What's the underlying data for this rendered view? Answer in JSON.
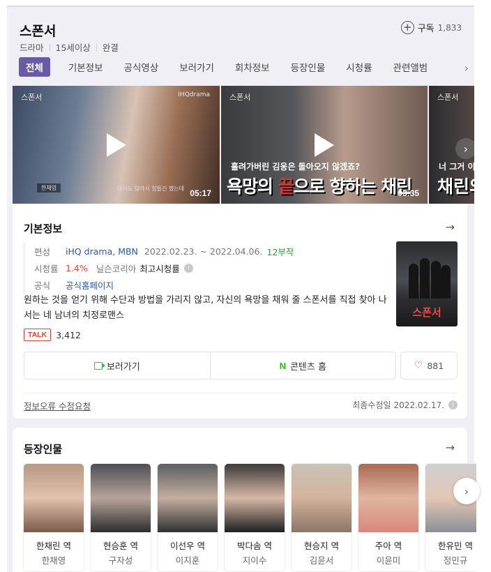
{
  "header": {
    "title": "스폰서",
    "subscribe_label": "구독",
    "subscribe_count": "1,833",
    "meta": [
      "드라마",
      "15세이상",
      "완결"
    ]
  },
  "tabs": [
    "전체",
    "기본정보",
    "공식영상",
    "보러가기",
    "회차정보",
    "등장인물",
    "시청률",
    "관련앨범"
  ],
  "videos": [
    {
      "logo": "스폰서",
      "brand": "IHQdrama",
      "duration": "05:17",
      "caption_name": "한채영",
      "caption_text": "대사도 많아서 힘들긴 했는데"
    },
    {
      "logo": "스폰서",
      "duration": "03:35",
      "caption_small": "흘려가버린 김웅은 돌아오지 않겠죠?",
      "caption_big_a": "욕망의 ",
      "caption_big_red": "끝",
      "caption_big_b": "으로 향하는 채린"
    },
    {
      "logo": "스폰서",
      "caption_small": "너 그거 이",
      "caption_big": "채린의"
    }
  ],
  "basic_info": {
    "section_title": "기본정보",
    "broadcast_label": "편성",
    "channels": "iHQ drama, MBN",
    "period": "2022.02.23. ~ 2022.04.06.",
    "episodes": "12부작",
    "rating_label": "시청률",
    "rating_value": "1.4%",
    "rating_source": "닐슨코리아",
    "rating_note": "최고시청률",
    "official_label": "공식",
    "official_link": "공식홈페이지",
    "description": "원하는 것을 얻기 위해 수단과 방법을 가리지 않고, 자신의 욕망을 채워 줄 스폰서를 직접 찾아 나서는 네 남녀의 치정로맨스",
    "talk_badge": "TALK",
    "talk_count": "3,412",
    "poster_title": "스폰서",
    "watch_button": "보러가기",
    "content_home_icon": "N",
    "content_home_button": "콘텐츠 홈",
    "like_count": "881",
    "report_link": "정보오류 수정요청",
    "updated_label": "최종수정일",
    "updated_date": "2022.02.17."
  },
  "cast_section": {
    "title": "등장인물",
    "members": [
      {
        "role": "한채린 역",
        "actor": "한채영"
      },
      {
        "role": "현승훈 역",
        "actor": "구자성"
      },
      {
        "role": "이선우 역",
        "actor": "이지훈"
      },
      {
        "role": "박다솜 역",
        "actor": "지이수"
      },
      {
        "role": "현승지 역",
        "actor": "김윤서"
      },
      {
        "role": "주아 역",
        "actor": "이윤미"
      },
      {
        "role": "한유민 역",
        "actor": "정민규"
      }
    ]
  },
  "colors": {
    "accent": "#6a5ba5",
    "link": "#2a59a8",
    "green": "#31a33a",
    "red": "#e4442f",
    "panel_bg": "#f0eff5"
  }
}
